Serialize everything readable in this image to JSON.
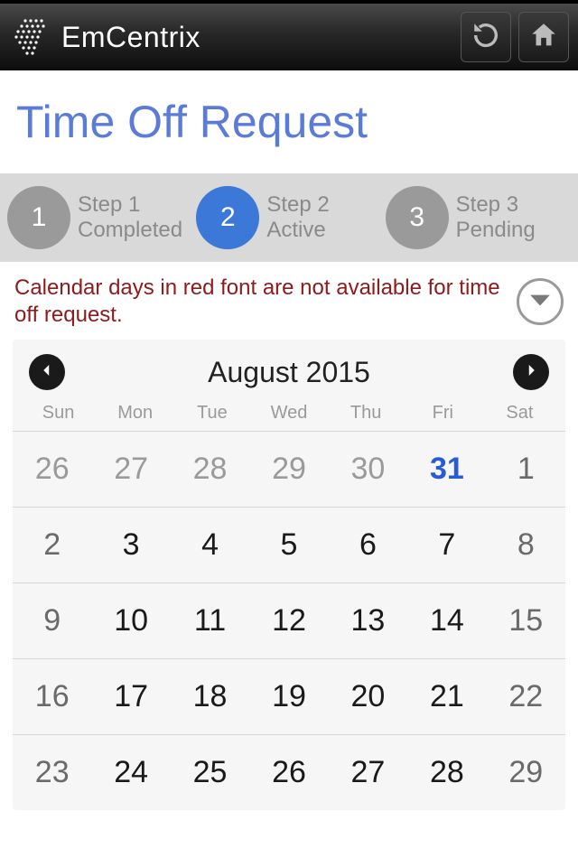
{
  "header": {
    "brand": "EmCentrix"
  },
  "page": {
    "title": "Time Off Request"
  },
  "steps": [
    {
      "num": "1",
      "label1": "Step 1",
      "label2": "Completed",
      "state": "done"
    },
    {
      "num": "2",
      "label1": "Step 2",
      "label2": "Active",
      "state": "active"
    },
    {
      "num": "3",
      "label1": "Step 3",
      "label2": "Pending",
      "state": "pending"
    }
  ],
  "notice": "Calendar days in red font are not available for time off request.",
  "calendar": {
    "title": "August 2015",
    "dow": [
      "Sun",
      "Mon",
      "Tue",
      "Wed",
      "Thu",
      "Fri",
      "Sat"
    ],
    "rows": [
      [
        {
          "n": "26",
          "cls": "out"
        },
        {
          "n": "27",
          "cls": "out"
        },
        {
          "n": "28",
          "cls": "out"
        },
        {
          "n": "29",
          "cls": "out"
        },
        {
          "n": "30",
          "cls": "out"
        },
        {
          "n": "31",
          "cls": "highlight"
        },
        {
          "n": "1",
          "cls": "weekend"
        }
      ],
      [
        {
          "n": "2",
          "cls": "weekend"
        },
        {
          "n": "3",
          "cls": ""
        },
        {
          "n": "4",
          "cls": ""
        },
        {
          "n": "5",
          "cls": ""
        },
        {
          "n": "6",
          "cls": ""
        },
        {
          "n": "7",
          "cls": ""
        },
        {
          "n": "8",
          "cls": "weekend"
        }
      ],
      [
        {
          "n": "9",
          "cls": "weekend"
        },
        {
          "n": "10",
          "cls": ""
        },
        {
          "n": "11",
          "cls": ""
        },
        {
          "n": "12",
          "cls": ""
        },
        {
          "n": "13",
          "cls": ""
        },
        {
          "n": "14",
          "cls": ""
        },
        {
          "n": "15",
          "cls": "weekend"
        }
      ],
      [
        {
          "n": "16",
          "cls": "weekend"
        },
        {
          "n": "17",
          "cls": ""
        },
        {
          "n": "18",
          "cls": ""
        },
        {
          "n": "19",
          "cls": ""
        },
        {
          "n": "20",
          "cls": ""
        },
        {
          "n": "21",
          "cls": ""
        },
        {
          "n": "22",
          "cls": "weekend"
        }
      ],
      [
        {
          "n": "23",
          "cls": "weekend"
        },
        {
          "n": "24",
          "cls": ""
        },
        {
          "n": "25",
          "cls": ""
        },
        {
          "n": "26",
          "cls": ""
        },
        {
          "n": "27",
          "cls": ""
        },
        {
          "n": "28",
          "cls": ""
        },
        {
          "n": "29",
          "cls": "weekend"
        }
      ]
    ]
  }
}
